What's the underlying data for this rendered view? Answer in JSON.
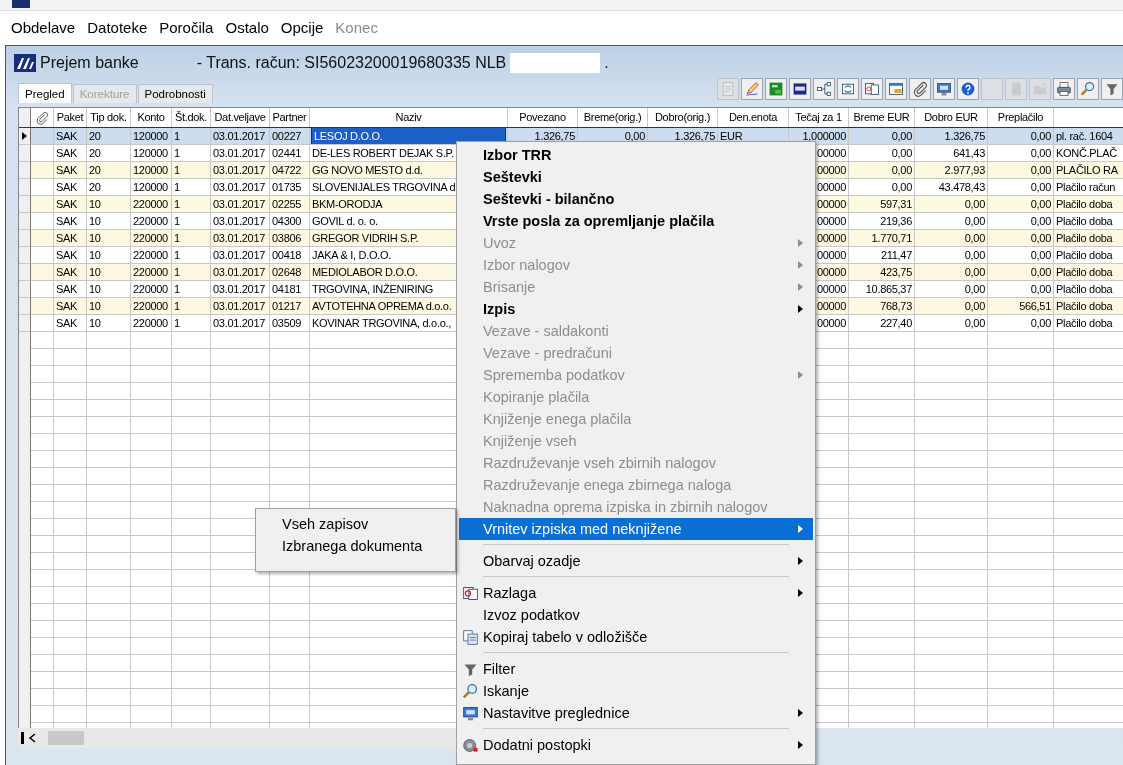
{
  "menubar": [
    {
      "label": "Obdelave",
      "disabled": false
    },
    {
      "label": "Datoteke",
      "disabled": false
    },
    {
      "label": "Poročila",
      "disabled": false
    },
    {
      "label": "Ostalo",
      "disabled": false
    },
    {
      "label": "Opcije",
      "disabled": false
    },
    {
      "label": "Konec",
      "disabled": true
    }
  ],
  "window": {
    "title": "Prejem banke",
    "subtitle": "- Trans. račun: SI56023200019680335  NLB",
    "subtitle_end": "."
  },
  "tabs": [
    {
      "label": "Pregled",
      "selected": true,
      "disabled": false
    },
    {
      "label": "Korekture",
      "selected": false,
      "disabled": true
    },
    {
      "label": "Podrobnosti",
      "selected": false,
      "disabled": false
    }
  ],
  "toolbar": [
    {
      "disabled": true
    },
    {
      "disabled": false
    },
    {
      "disabled": false
    },
    {
      "disabled": false
    },
    {
      "disabled": false
    },
    {
      "disabled": false
    },
    {
      "disabled": false
    },
    {
      "disabled": false
    },
    {
      "disabled": false
    },
    {
      "disabled": false
    },
    {
      "disabled": false
    },
    {
      "disabled": true
    },
    {
      "disabled": true
    },
    {
      "disabled": true
    },
    {
      "disabled": false
    },
    {
      "disabled": false
    },
    {
      "disabled": false
    }
  ],
  "table": {
    "columns": [
      {
        "label": "Paket",
        "kind": "text"
      },
      {
        "label": "Tip dok.",
        "kind": "text"
      },
      {
        "label": "Konto",
        "kind": "text"
      },
      {
        "label": "Št.dok.",
        "kind": "text"
      },
      {
        "label": "Dat.veljave",
        "kind": "text"
      },
      {
        "label": "Partner",
        "kind": "text"
      },
      {
        "label": "Naziv",
        "kind": "name"
      },
      {
        "label": "Povezano",
        "kind": "number"
      },
      {
        "label": "Breme(orig.)",
        "kind": "number"
      },
      {
        "label": "Dobro(orig.)",
        "kind": "number"
      },
      {
        "label": "Den.enota",
        "kind": "text"
      },
      {
        "label": "Tečaj za 1",
        "kind": "number"
      },
      {
        "label": "Breme EUR",
        "kind": "number"
      },
      {
        "label": "Dobro EUR",
        "kind": "number"
      },
      {
        "label": "Preplačilo",
        "kind": "number"
      },
      {
        "kind": "text"
      }
    ],
    "rows": [
      {
        "selected": true,
        "cells": [
          "SAK",
          "20",
          "120000",
          "1",
          "03.01.2017",
          "00227",
          "LESOJ D.O.O.",
          "1.326,75",
          "0,00",
          "1.326,75",
          "EUR",
          "1,000000",
          "0,00",
          "1.326,75",
          "0,00",
          "pl. rač. 1604"
        ]
      },
      {
        "selected": false,
        "cells": [
          "SAK",
          "20",
          "120000",
          "1",
          "03.01.2017",
          "02441",
          "DE-LES ROBERT DEJAK S.P.",
          null,
          null,
          null,
          null,
          "00000",
          "0,00",
          "641,43",
          "0,00",
          "KONČ.PLAČ"
        ]
      },
      {
        "selected": false,
        "cells": [
          "SAK",
          "20",
          "120000",
          "1",
          "03.01.2017",
          "04722",
          "GG NOVO MESTO d.d.",
          null,
          null,
          null,
          null,
          "00000",
          "0,00",
          "2.977,93",
          "0,00",
          "PLAČILO RA"
        ]
      },
      {
        "selected": false,
        "cells": [
          "SAK",
          "20",
          "120000",
          "1",
          "03.01.2017",
          "01735",
          "SLOVENIJALES TRGOVINA d",
          null,
          null,
          null,
          null,
          "00000",
          "0,00",
          "43.478,43",
          "0,00",
          "Plačilo račun"
        ]
      },
      {
        "selected": false,
        "cells": [
          "SAK",
          "10",
          "220000",
          "1",
          "03.01.2017",
          "02255",
          "BKM-ORODJA",
          null,
          null,
          null,
          null,
          "00000",
          "597,31",
          "0,00",
          "0,00",
          "Plačilo doba"
        ]
      },
      {
        "selected": false,
        "cells": [
          "SAK",
          "10",
          "220000",
          "1",
          "03.01.2017",
          "04300",
          "GOVIL d. o. o.",
          null,
          null,
          null,
          null,
          "00000",
          "219,36",
          "0,00",
          "0,00",
          "Plačilo doba"
        ]
      },
      {
        "selected": false,
        "cells": [
          "SAK",
          "10",
          "220000",
          "1",
          "03.01.2017",
          "03806",
          "GREGOR VIDRIH S.P.",
          null,
          null,
          null,
          null,
          "00000",
          "1.770,71",
          "0,00",
          "0,00",
          "Plačilo doba"
        ]
      },
      {
        "selected": false,
        "cells": [
          "SAK",
          "10",
          "220000",
          "1",
          "03.01.2017",
          "00418",
          "JAKA & I, D.O.O.",
          null,
          null,
          null,
          null,
          "00000",
          "211,47",
          "0,00",
          "0,00",
          "Plačilo doba"
        ]
      },
      {
        "selected": false,
        "cells": [
          "SAK",
          "10",
          "220000",
          "1",
          "03.01.2017",
          "02648",
          "MEDIOLABOR D.O.O.",
          null,
          null,
          null,
          null,
          "00000",
          "423,75",
          "0,00",
          "0,00",
          "Plačilo doba"
        ]
      },
      {
        "selected": false,
        "cells": [
          "SAK",
          "10",
          "220000",
          "1",
          "03.01.2017",
          "04181",
          "TRGOVINA, INŽENIRING",
          null,
          null,
          null,
          null,
          "00000",
          "10.865,37",
          "0,00",
          "0,00",
          "Plačilo doba"
        ]
      },
      {
        "selected": false,
        "cells": [
          "SAK",
          "10",
          "220000",
          "1",
          "03.01.2017",
          "01217",
          "AVTOTEHNA OPREMA d.o.o.",
          null,
          null,
          null,
          null,
          "00000",
          "768,73",
          "0,00",
          "566,51",
          "Plačilo doba"
        ]
      },
      {
        "selected": false,
        "cells": [
          "SAK",
          "10",
          "220000",
          "1",
          "03.01.2017",
          "03509",
          "KOVINAR TRGOVINA, d.o.o.,",
          null,
          null,
          null,
          null,
          "00000",
          "227,40",
          "0,00",
          "0,00",
          "Plačilo doba"
        ]
      }
    ]
  },
  "context_menu": {
    "items": [
      {
        "kind": "item",
        "label": "Izbor TRR",
        "disabled": false,
        "bold": true,
        "submenu": false,
        "selected": false
      },
      {
        "kind": "item",
        "label": "Seštevki",
        "disabled": false,
        "bold": true,
        "submenu": false,
        "selected": false
      },
      {
        "kind": "item",
        "label": "Seštevki - bilančno",
        "disabled": false,
        "bold": true,
        "submenu": false,
        "selected": false
      },
      {
        "kind": "item",
        "label": "Vrste posla za opremljanje plačila",
        "disabled": false,
        "bold": true,
        "submenu": false,
        "selected": false
      },
      {
        "kind": "item",
        "label": "Uvoz",
        "disabled": true,
        "bold": false,
        "submenu": true,
        "selected": false
      },
      {
        "kind": "item",
        "label": "Izbor nalogov",
        "disabled": true,
        "bold": false,
        "submenu": true,
        "selected": false
      },
      {
        "kind": "item",
        "label": "Brisanje",
        "disabled": true,
        "bold": false,
        "submenu": true,
        "selected": false
      },
      {
        "kind": "item",
        "label": "Izpis",
        "disabled": false,
        "bold": true,
        "submenu": true,
        "selected": false
      },
      {
        "kind": "item",
        "label": "Vezave - saldakonti",
        "disabled": true,
        "bold": false,
        "submenu": false,
        "selected": false
      },
      {
        "kind": "item",
        "label": "Vezave - predračuni",
        "disabled": true,
        "bold": false,
        "submenu": false,
        "selected": false
      },
      {
        "kind": "item",
        "label": "Sprememba podatkov",
        "disabled": true,
        "bold": false,
        "submenu": true,
        "selected": false
      },
      {
        "kind": "item",
        "label": "Kopiranje plačila",
        "disabled": true,
        "bold": false,
        "submenu": false,
        "selected": false
      },
      {
        "kind": "item",
        "label": "Knjiženje enega plačila",
        "disabled": true,
        "bold": false,
        "submenu": false,
        "selected": false
      },
      {
        "kind": "item",
        "label": "Knjiženje vseh",
        "disabled": true,
        "bold": false,
        "submenu": false,
        "selected": false
      },
      {
        "kind": "item",
        "label": "Razdruževanje vseh zbirnih nalogov",
        "disabled": true,
        "bold": false,
        "submenu": false,
        "selected": false
      },
      {
        "kind": "item",
        "label": "Razdruževanje enega zbirnega naloga",
        "disabled": true,
        "bold": false,
        "submenu": false,
        "selected": false
      },
      {
        "kind": "item",
        "label": "Naknadna oprema izpiska in zbirnih nalogov",
        "disabled": true,
        "bold": false,
        "submenu": false,
        "selected": false
      },
      {
        "kind": "item",
        "label": "Vrnitev izpiska med neknjižene",
        "disabled": false,
        "bold": false,
        "submenu": true,
        "selected": true
      },
      {
        "kind": "separator"
      },
      {
        "kind": "item",
        "label": "Obarvaj ozadje",
        "disabled": false,
        "bold": false,
        "submenu": true,
        "selected": false
      },
      {
        "kind": "separator"
      },
      {
        "kind": "item",
        "label": "Razlaga",
        "disabled": false,
        "bold": false,
        "submenu": true,
        "selected": false
      },
      {
        "kind": "item",
        "label": "Izvoz podatkov",
        "disabled": false,
        "bold": false,
        "submenu": false,
        "selected": false
      },
      {
        "kind": "item",
        "label": "Kopiraj tabelo v odložišče",
        "disabled": false,
        "bold": false,
        "submenu": false,
        "selected": false
      },
      {
        "kind": "separator"
      },
      {
        "kind": "item",
        "label": "Filter",
        "disabled": false,
        "bold": false,
        "submenu": false,
        "selected": false
      },
      {
        "kind": "item",
        "label": "Iskanje",
        "disabled": false,
        "bold": false,
        "submenu": false,
        "selected": false
      },
      {
        "kind": "item",
        "label": "Nastavitve preglednice",
        "disabled": false,
        "bold": false,
        "submenu": true,
        "selected": false
      },
      {
        "kind": "separator"
      },
      {
        "kind": "item",
        "label": "Dodatni postopki",
        "disabled": false,
        "bold": false,
        "submenu": true,
        "selected": false
      }
    ]
  },
  "submenu": {
    "items": [
      {
        "label": "Vseh zapisov",
        "selected": false
      },
      {
        "label": "Izbranega dokumenta",
        "selected": false
      }
    ]
  }
}
